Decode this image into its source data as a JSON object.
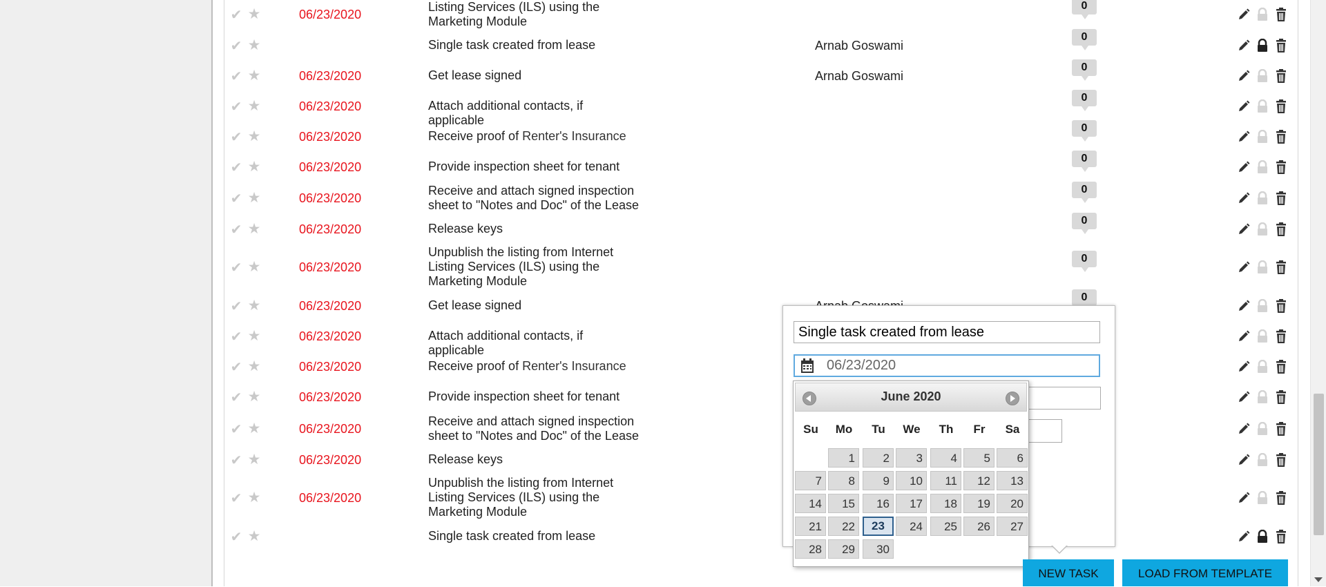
{
  "tasks": [
    {
      "date": "06/23/2020",
      "title_lines": [
        "Listing Services (ILS) using the",
        "Marketing Module"
      ],
      "title_suffix": "",
      "assignee": "",
      "count": "0",
      "locked": false
    },
    {
      "date": "",
      "title_lines": [
        "Single task created from lease"
      ],
      "title_suffix": "",
      "assignee": "Arnab Goswami",
      "count": "0",
      "locked": true
    },
    {
      "date": "06/23/2020",
      "title_lines": [
        "Get lease signed"
      ],
      "title_suffix": "",
      "assignee": "Arnab Goswami",
      "count": "0",
      "locked": false
    },
    {
      "date": "06/23/2020",
      "title_lines": [
        "Attach additional contacts, if applicable"
      ],
      "title_suffix": "",
      "assignee": "",
      "count": "0",
      "locked": false
    },
    {
      "date": "06/23/2020",
      "title_lines": [
        "Receive proof of "
      ],
      "title_suffix": "Renter's Insurance",
      "assignee": "",
      "count": "0",
      "locked": false
    },
    {
      "date": "06/23/2020",
      "title_lines": [
        "Provide inspection sheet for tenant"
      ],
      "title_suffix": "",
      "assignee": "",
      "count": "0",
      "locked": false
    },
    {
      "date": "06/23/2020",
      "title_lines": [
        "Receive and attach signed inspection",
        "sheet to \"Notes and Doc\" of the Lease"
      ],
      "title_suffix": "",
      "assignee": "",
      "count": "0",
      "locked": false
    },
    {
      "date": "06/23/2020",
      "title_lines": [
        "Release keys"
      ],
      "title_suffix": "",
      "assignee": "",
      "count": "0",
      "locked": false
    },
    {
      "date": "06/23/2020",
      "title_lines": [
        "Unpublish the listing from Internet",
        "Listing Services (ILS) using the",
        "Marketing Module"
      ],
      "title_suffix": "",
      "assignee": "",
      "count": "0",
      "locked": false
    },
    {
      "date": "06/23/2020",
      "title_lines": [
        "Get lease signed"
      ],
      "title_suffix": "",
      "assignee": "Arnab Goswami",
      "count": "0",
      "locked": false
    },
    {
      "date": "06/23/2020",
      "title_lines": [
        "Attach additional contacts, if applicable"
      ],
      "title_suffix": "",
      "assignee": "",
      "count": "",
      "locked": false
    },
    {
      "date": "06/23/2020",
      "title_lines": [
        "Receive proof of "
      ],
      "title_suffix": "Renter's Insurance",
      "assignee": "",
      "count": "",
      "locked": false
    },
    {
      "date": "06/23/2020",
      "title_lines": [
        "Provide inspection sheet for tenant"
      ],
      "title_suffix": "",
      "assignee": "",
      "count": "",
      "locked": false
    },
    {
      "date": "06/23/2020",
      "title_lines": [
        "Receive and attach signed inspection",
        "sheet to \"Notes and Doc\" of the Lease"
      ],
      "title_suffix": "",
      "assignee": "",
      "count": "",
      "locked": false
    },
    {
      "date": "06/23/2020",
      "title_lines": [
        "Release keys"
      ],
      "title_suffix": "",
      "assignee": "",
      "count": "",
      "locked": false
    },
    {
      "date": "06/23/2020",
      "title_lines": [
        "Unpublish the listing from Internet",
        "Listing Services (ILS) using the",
        "Marketing Module"
      ],
      "title_suffix": "",
      "assignee": "",
      "count": "",
      "locked": false
    },
    {
      "date": "",
      "title_lines": [
        "Single task created from lease"
      ],
      "title_suffix": "",
      "assignee": "",
      "count": "",
      "locked": true
    }
  ],
  "popup": {
    "title_value": "Single task created from lease",
    "date_value": "06/23/2020"
  },
  "calendar": {
    "month_label": "June 2020",
    "weekdays": [
      "Su",
      "Mo",
      "Tu",
      "We",
      "Th",
      "Fr",
      "Sa"
    ],
    "first_weekday_index": 1,
    "days_in_month": 30,
    "selected_day": 23
  },
  "buttons": {
    "new_task": "NEW TASK",
    "load_template": "LOAD FROM TEMPLATE"
  },
  "icons": {
    "complete": "check-icon",
    "favorite": "star-icon",
    "edit": "pencil-icon",
    "lock": "lock-icon",
    "delete": "trash-icon",
    "calendar": "calendar-icon"
  },
  "colors": {
    "overdue_date": "#e8141d",
    "button": "#0fa7e0",
    "selected_day_border": "#2e5f8d"
  }
}
